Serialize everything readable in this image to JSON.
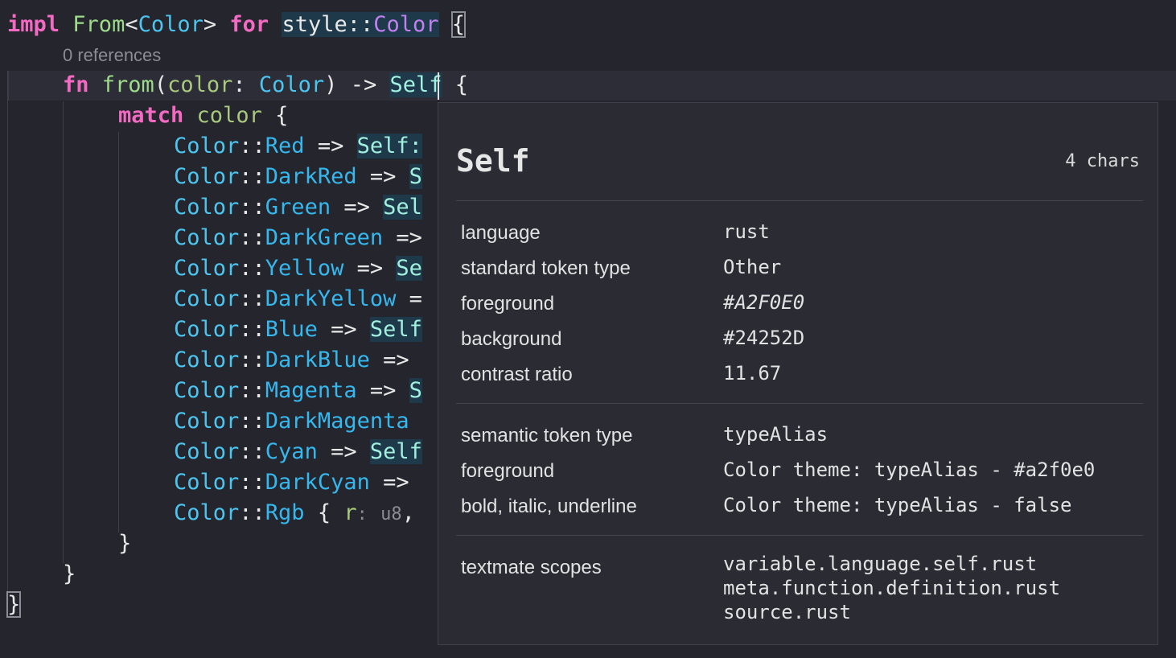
{
  "code": {
    "line1": {
      "impl": "impl",
      "from": "From",
      "lt": "<",
      "color": "Color",
      "gt": ">",
      "for": "for",
      "style": "style",
      "sep": "::",
      "styleColor": "Color",
      "brace": "{"
    },
    "codelens": "0 references",
    "line2": {
      "fn": "fn",
      "from": "from",
      "open": "(",
      "param": "color",
      "colon": ":",
      "ptype": "Color",
      "close": ")",
      "arrow": "->",
      "self": "Self",
      "brace": "{"
    },
    "line3": {
      "match": "match",
      "var": "color",
      "brace": "{"
    },
    "arms": [
      {
        "enum": "Color",
        "sep": "::",
        "variant": "Red",
        "rest": "=>",
        "tail": "Self:"
      },
      {
        "enum": "Color",
        "sep": "::",
        "variant": "DarkRed",
        "rest": "=>",
        "tail": "S"
      },
      {
        "enum": "Color",
        "sep": "::",
        "variant": "Green",
        "rest": "=>",
        "tail": "Sel"
      },
      {
        "enum": "Color",
        "sep": "::",
        "variant": "DarkGreen",
        "rest": "=>",
        "tail": ""
      },
      {
        "enum": "Color",
        "sep": "::",
        "variant": "Yellow",
        "rest": "=>",
        "tail": "Se"
      },
      {
        "enum": "Color",
        "sep": "::",
        "variant": "DarkYellow",
        "rest": "=",
        "tail": ""
      },
      {
        "enum": "Color",
        "sep": "::",
        "variant": "Blue",
        "rest": "=>",
        "tail": "Self"
      },
      {
        "enum": "Color",
        "sep": "::",
        "variant": "DarkBlue",
        "rest": "=>",
        "tail": ""
      },
      {
        "enum": "Color",
        "sep": "::",
        "variant": "Magenta",
        "rest": "=>",
        "tail": "S"
      },
      {
        "enum": "Color",
        "sep": "::",
        "variant": "DarkMagenta",
        "rest": "",
        "tail": ""
      },
      {
        "enum": "Color",
        "sep": "::",
        "variant": "Cyan",
        "rest": "=>",
        "tail": "Self"
      },
      {
        "enum": "Color",
        "sep": "::",
        "variant": "DarkCyan",
        "rest": "=>",
        "tail": ""
      }
    ],
    "rgbArm": {
      "enum": "Color",
      "sep": "::",
      "variant": "Rgb",
      "brace": "{",
      "field": "r",
      "colon": ":",
      "hint": "u8",
      "comma": ","
    },
    "closeMatch": "}",
    "closeFn": "}",
    "closeImpl": "}"
  },
  "hover": {
    "title": "Self",
    "chars": "4 chars",
    "general": [
      {
        "key": "language",
        "value": "rust"
      },
      {
        "key": "standard token type",
        "value": "Other"
      },
      {
        "key": "foreground",
        "value": "#A2F0E0"
      },
      {
        "key": "background",
        "value": "#24252D"
      },
      {
        "key": "contrast ratio",
        "value": "11.67"
      }
    ],
    "semantic": [
      {
        "key": "semantic token type",
        "value": "typeAlias"
      },
      {
        "key": "foreground",
        "value": "Color theme: typeAlias - #a2f0e0"
      },
      {
        "key": "bold, italic, underline",
        "value": "Color theme: typeAlias - false"
      }
    ],
    "textmate": {
      "key": "textmate scopes",
      "scopes": [
        "variable.language.self.rust",
        "meta.function.definition.rust",
        "source.rust"
      ]
    }
  },
  "colors": {
    "background": "#24252D",
    "keyword": "#F26AC2",
    "function": "#9EDB8A",
    "type": "#4CC6F0",
    "self": "#A2F0E0",
    "variant": "#36B8EE"
  }
}
